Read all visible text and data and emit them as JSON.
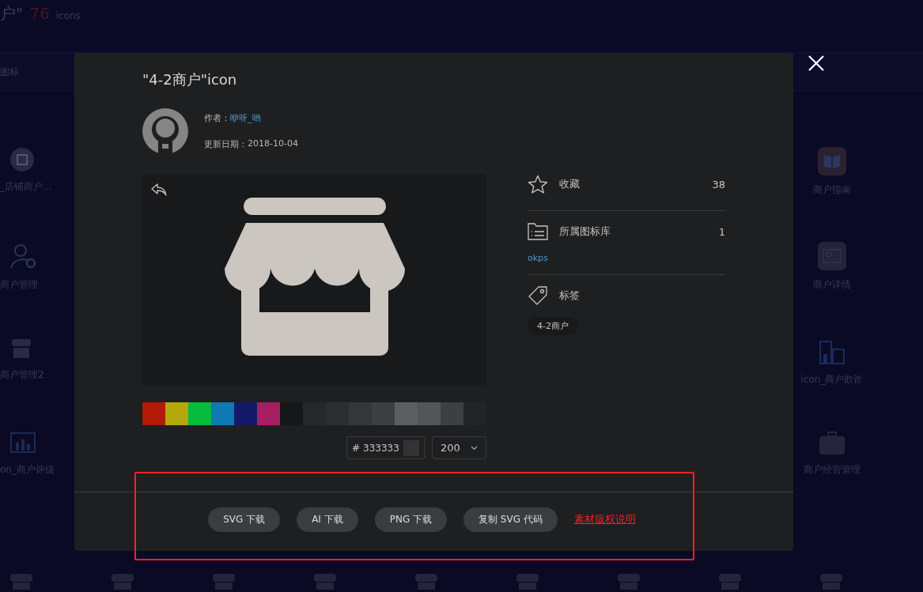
{
  "page": {
    "title": "户\"",
    "count": "76",
    "count_unit": "icons",
    "search_text": "图标"
  },
  "left_icons": [
    {
      "label": "_店铺商户..."
    },
    {
      "label": "商户管理"
    },
    {
      "label": "商户管理2"
    },
    {
      "label": "on_商户评级"
    }
  ],
  "right_icons": [
    {
      "label": "商户指南"
    },
    {
      "label": "商户详情"
    },
    {
      "label": "icon_商户欺诈"
    },
    {
      "label": "商户经营管理"
    }
  ],
  "dialog": {
    "title": "\"4-2商户\"icon",
    "author_label": "作者：",
    "author": "咿呀_哟",
    "date_label": "更新日期：",
    "date": "2018-10-04",
    "swatches": [
      {
        "color": "#b11a04"
      },
      {
        "color": "#b3a80c"
      },
      {
        "color": "#06bc3d"
      },
      {
        "color": "#0e79b2"
      },
      {
        "color": "#111b68"
      },
      {
        "color": "#a81e63"
      },
      {
        "color": "#161719"
      },
      {
        "color": "#25292c"
      },
      {
        "color": "#2b2e31"
      },
      {
        "color": "#33373a"
      },
      {
        "color": "#3b3f42"
      },
      {
        "color": "#5a5f62"
      },
      {
        "color": "#515659"
      },
      {
        "color": "#3c4043"
      },
      {
        "color": "#222527"
      }
    ],
    "color_prefix": "#",
    "color_value": "333333",
    "size": "200",
    "favorites_label": "收藏",
    "favorites": "38",
    "library_label": "所属图标库",
    "library_count": "1",
    "library": "okps",
    "tags_label": "标签",
    "tags": [
      "4-2商户"
    ],
    "buttons": [
      "SVG 下载",
      "AI 下载",
      "PNG 下载",
      "复制 SVG 代码"
    ],
    "copyright_link": "素材版权说明"
  }
}
